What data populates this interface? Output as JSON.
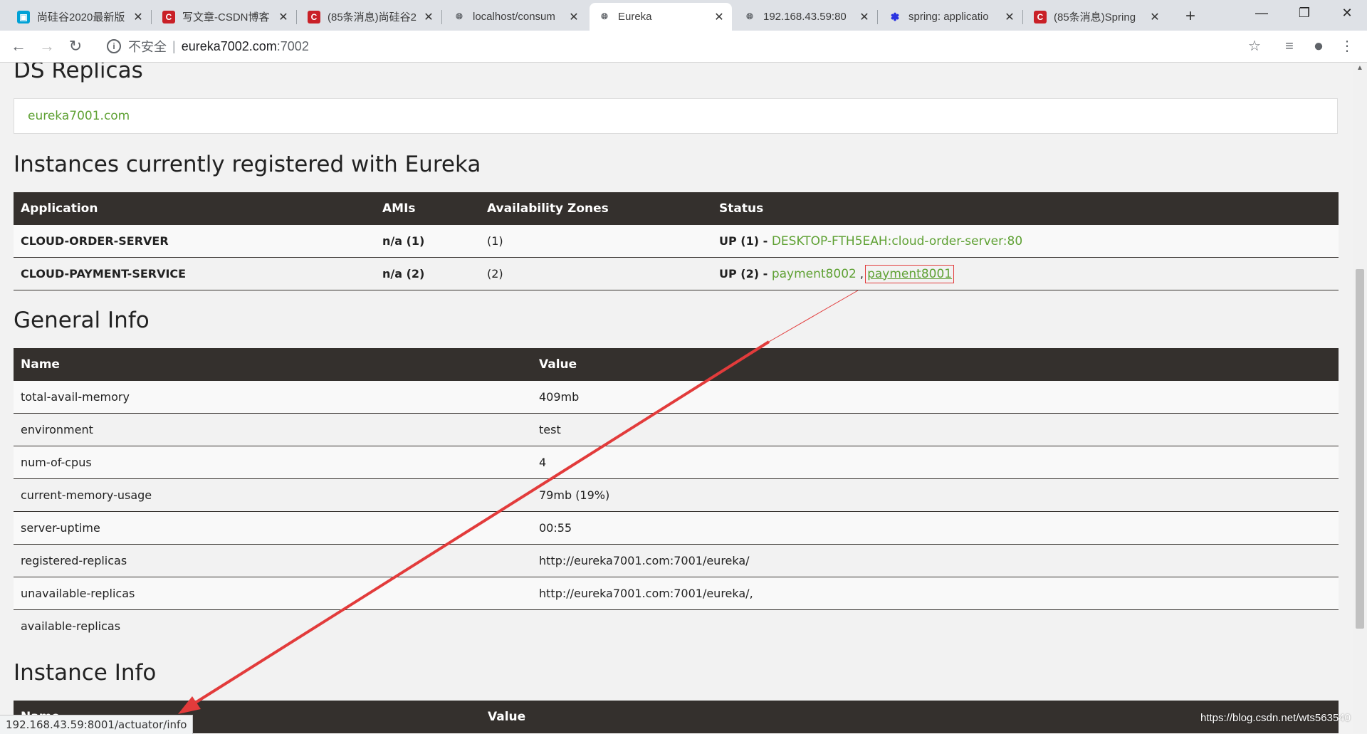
{
  "browser": {
    "tabs": [
      {
        "title": "尚硅谷2020最新版",
        "icon": "bilibili-icon"
      },
      {
        "title": "写文章-CSDN博客",
        "icon": "csdn-icon"
      },
      {
        "title": "(85条消息)尚硅谷2",
        "icon": "csdn-icon"
      },
      {
        "title": "localhost/consum",
        "icon": "globe-icon"
      },
      {
        "title": "Eureka",
        "icon": "globe-icon",
        "active": true
      },
      {
        "title": "192.168.43.59:80",
        "icon": "globe-icon"
      },
      {
        "title": "spring: applicatio",
        "icon": "baidu-paw-icon"
      },
      {
        "title": "(85条消息)Spring",
        "icon": "csdn-icon"
      }
    ],
    "address": {
      "security_label": "不安全",
      "host": "eureka7002.com",
      "port": ":7002"
    }
  },
  "ds_replicas": {
    "heading": "DS Replicas",
    "items": [
      "eureka7001.com"
    ]
  },
  "instances": {
    "heading": "Instances currently registered with Eureka",
    "columns": [
      "Application",
      "AMIs",
      "Availability Zones",
      "Status"
    ],
    "rows": [
      {
        "application": "CLOUD-ORDER-SERVER",
        "amis": "n/a (1)",
        "zones": "(1)",
        "status_prefix": "UP (1) - ",
        "links": [
          "DESKTOP-FTH5EAH:cloud-order-server:80"
        ]
      },
      {
        "application": "CLOUD-PAYMENT-SERVICE",
        "amis": "n/a (2)",
        "zones": "(2)",
        "status_prefix": "UP (2) - ",
        "links": [
          "payment8002",
          "payment8001"
        ],
        "separator": " , "
      }
    ]
  },
  "general_info": {
    "heading": "General Info",
    "columns": [
      "Name",
      "Value"
    ],
    "rows": [
      {
        "name": "total-avail-memory",
        "value": "409mb"
      },
      {
        "name": "environment",
        "value": "test"
      },
      {
        "name": "num-of-cpus",
        "value": "4"
      },
      {
        "name": "current-memory-usage",
        "value": "79mb (19%)"
      },
      {
        "name": "server-uptime",
        "value": "00:55"
      },
      {
        "name": "registered-replicas",
        "value": "http://eureka7001.com:7001/eureka/"
      },
      {
        "name": "unavailable-replicas",
        "value": "http://eureka7001.com:7001/eureka/,"
      },
      {
        "name": "available-replicas",
        "value": ""
      }
    ]
  },
  "instance_info": {
    "heading": "Instance Info",
    "columns": [
      "Name",
      "Value"
    ]
  },
  "status_bar_url": "192.168.43.59:8001/actuator/info",
  "watermark": "https://blog.csdn.net/wts563540",
  "colors": {
    "link": "#5fa134",
    "header_bg": "#34302d",
    "annotation": "#e23b3b"
  }
}
